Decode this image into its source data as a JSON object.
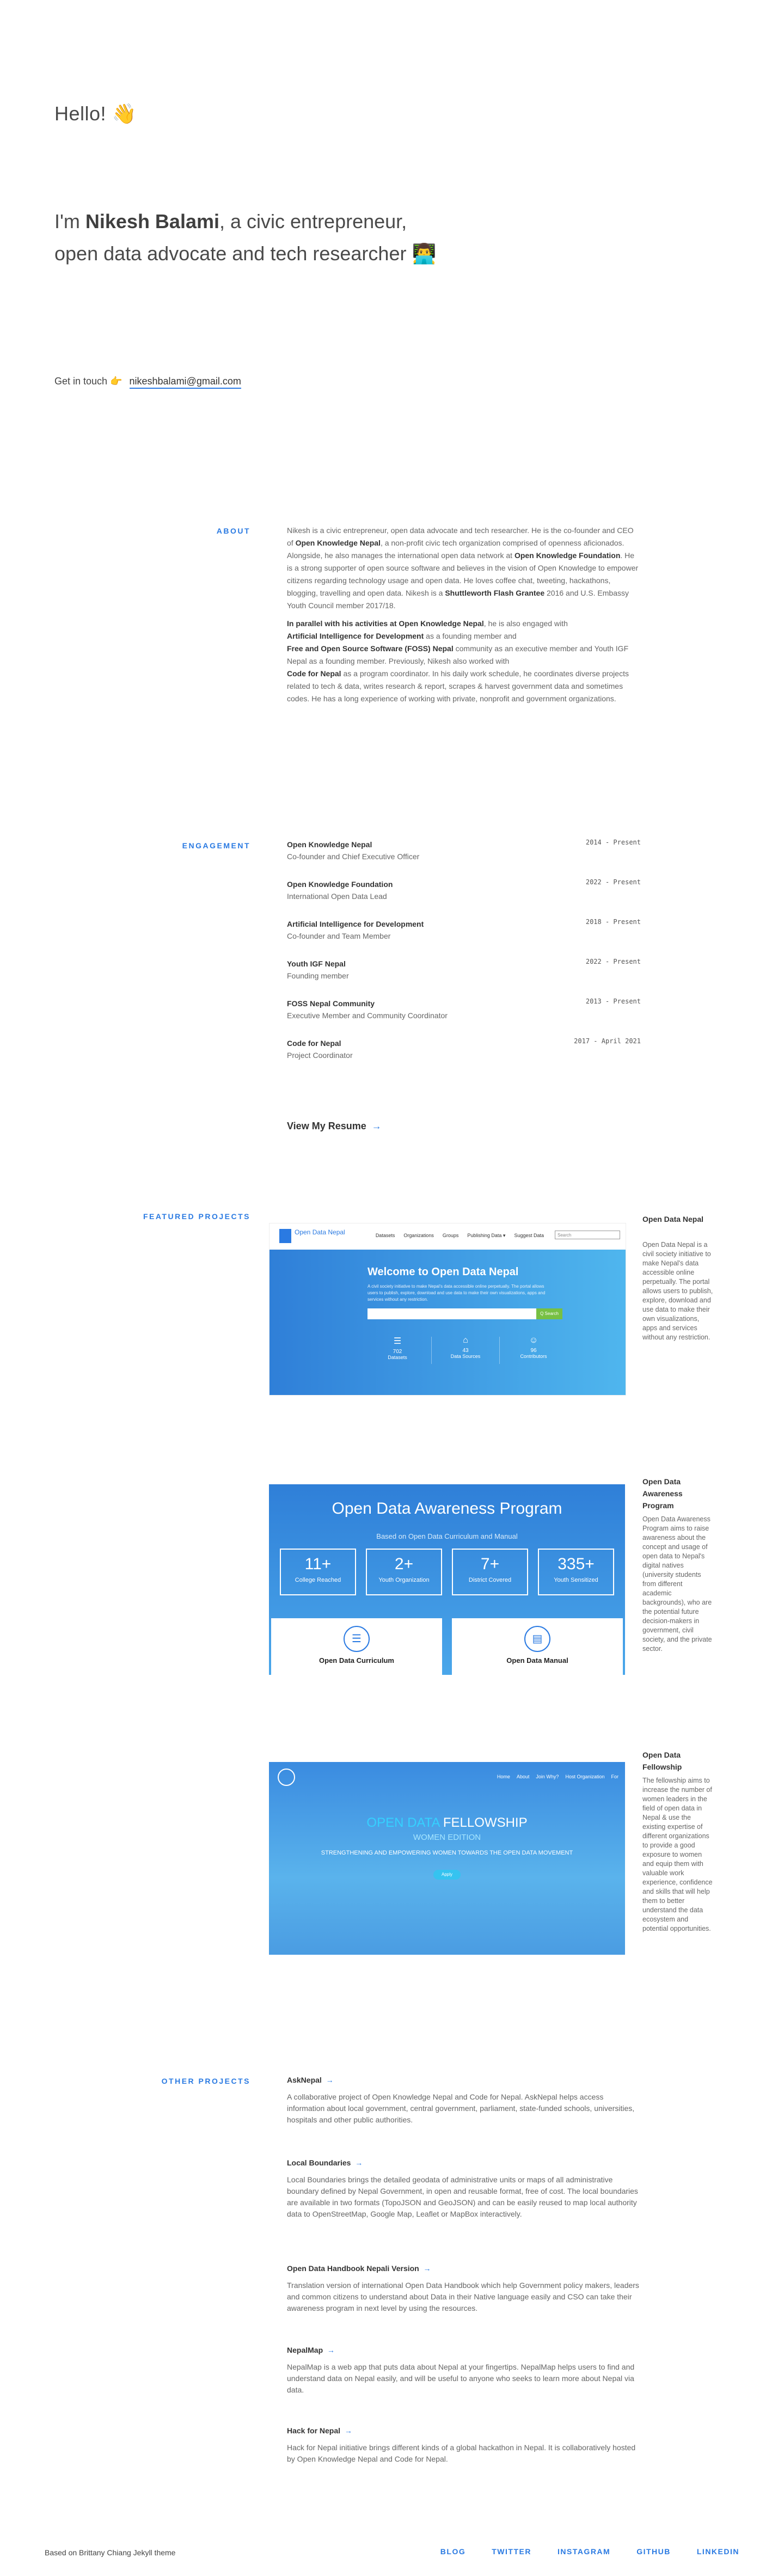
{
  "hero": {
    "greeting": "Hello! 👋",
    "intro_prefix": "I'm ",
    "intro_name": "Nikesh Balami",
    "intro_suffix": ", a civic entrepreneur, open data advocate and tech researcher 👨‍💻",
    "contact_label": "Get in touch 👉",
    "email": "nikeshbalami@gmail.com"
  },
  "about": {
    "label": "ABOUT",
    "p1_a": "Nikesh is a civic entrepreneur, open data advocate and tech researcher. He is the co-founder and CEO of ",
    "p1_b": "Open Knowledge Nepal",
    "p1_c": ", a non-profit civic tech organization comprised of openness aficionados. Alongside, he also manages the international open data network at ",
    "p1_d": "Open Knowledge Foundation",
    "p1_e": ". He is a strong supporter of open source software and believes in the vision of Open Knowledge to empower citizens regarding technology usage and open data. He loves coffee chat, tweeting, hackathons, blogging, travelling and open data. Nikesh is a ",
    "p1_f": "Shuttleworth Flash Grantee",
    "p1_g": " 2016 and U.S. Embassy Youth Council member 2017/18.",
    "p2_a": "In parallel with his activities at Open Knowledge Nepal",
    "p2_b": ", he is also engaged with ",
    "p2_c": "Artificial Intelligence for Development",
    "p2_d": " as a founding member and ",
    "p2_e": "Free and Open Source Software (FOSS) Nepal",
    "p2_f": " community as an executive member and Youth IGF Nepal as a founding member. Previously, Nikesh also worked with ",
    "p2_g": "Code for Nepal",
    "p2_h": " as a program coordinator. In his daily work schedule, he coordinates diverse projects related to tech & data, writes research & report, scrapes & harvest government data and sometimes codes. He has a long experience of working with private, nonprofit and government organizations."
  },
  "engagement": {
    "label": "ENGAGEMENT",
    "items": [
      {
        "org": "Open Knowledge Nepal",
        "role": "Co-founder and Chief Executive Officer",
        "date": "2014 - Present"
      },
      {
        "org": "Open Knowledge Foundation",
        "role": "International Open Data Lead",
        "date": "2022 - Present"
      },
      {
        "org": "Artificial Intelligence for Development",
        "role": "Co-founder and Team Member",
        "date": "2018 - Present"
      },
      {
        "org": "Youth IGF Nepal",
        "role": "Founding member",
        "date": "2022 - Present"
      },
      {
        "org": "FOSS Nepal Community",
        "role": "Executive Member and Community Coordinator",
        "date": "2013 - Present"
      },
      {
        "org": "Code for Nepal",
        "role": "Project Coordinator",
        "date": "2017 - April 2021"
      }
    ],
    "resume_label": "View My Resume",
    "resume_arrow": "→"
  },
  "featured": {
    "label": "FEATURED PROJECTS",
    "projects": [
      {
        "name": "Open Data Nepal",
        "desc": "Open Data Nepal is a civil society initiative to make Nepal's data accessible online perpetually. The portal allows users to publish, explore, download and use data to make their own visualizations, apps and services without any restriction.",
        "shot": {
          "logo": "Open Data Nepal",
          "nav": [
            "Datasets",
            "Organizations",
            "Groups",
            "Publishing Data ▾",
            "Suggest Data"
          ],
          "search": "Search",
          "title": "Welcome to Open Data Nepal",
          "text": "A civil society initiative to make Nepal's data accessible online perpetually. The portal allows users to publish, explore, download and use data to make their own visualizations, apps and services without any restriction.",
          "search_btn": "Q Search",
          "stats": [
            {
              "icon": "☰",
              "value": "702",
              "label": "Datasets"
            },
            {
              "icon": "⌂",
              "value": "43",
              "label": "Data Sources"
            },
            {
              "icon": "☺",
              "value": "96",
              "label": "Contributors"
            }
          ]
        }
      },
      {
        "name": "Open Data Awareness Program",
        "desc": "Open Data Awareness Program aims to raise awareness about the concept and usage of open data to Nepal's digital natives (university students from different academic backgrounds), who are the potential future decision-makers in government, civil society, and the private sector.",
        "shot": {
          "title": "Open Data Awareness Program",
          "subtitle": "Based on Open Data Curriculum and Manual",
          "stats": [
            {
              "value": "11+",
              "label": "College Reached"
            },
            {
              "value": "2+",
              "label": "Youth Organization"
            },
            {
              "value": "7+",
              "label": "District Covered"
            },
            {
              "value": "335+",
              "label": "Youth Sensitized"
            }
          ],
          "cards": [
            "Open Data Curriculum",
            "Open Data Manual"
          ]
        }
      },
      {
        "name": "Open Data Fellowship",
        "desc": "The fellowship aims to increase the number of women leaders in the field of open data in Nepal & use the existing expertise of different organizations to provide a good exposure to women and equip them with valuable work experience, confidence and skills that will help them to better understand the data ecosystem and potential opportunities.",
        "shot": {
          "nav": [
            "Home",
            "About",
            "Join Why?",
            "Host Organization",
            "For"
          ],
          "title_a": "OPEN DATA ",
          "title_b": "FELLOWSHIP",
          "subtitle": "WOMEN EDITION",
          "tagline": "STRENGTHENING AND EMPOWERING WOMEN TOWARDS THE OPEN DATA MOVEMENT",
          "button": "Apply"
        }
      }
    ]
  },
  "other": {
    "label": "OTHER PROJECTS",
    "projects": [
      {
        "name": "AskNepal",
        "desc": "A collaborative project of Open Knowledge Nepal and Code for Nepal. AskNepal helps access information about local government, central government, parliament, state-funded schools, universities, hospitals and other public authorities."
      },
      {
        "name": "Local Boundaries",
        "desc": "Local Boundaries brings the detailed geodata of administrative units or maps of all administrative boundary defined by Nepal Government, in open and reusable format, free of cost. The local boundaries are available in two formats (TopoJSON and GeoJSON) and can be easily reused to map local authority data to OpenStreetMap, Google Map, Leaflet or MapBox interactively."
      },
      {
        "name": "Open Data Handbook Nepali Version",
        "desc": "Translation version of international Open Data Handbook which help Government policy makers, leaders and common citizens to understand about Data in their Native language easily and CSO can take their awareness program in next level by using the resources."
      },
      {
        "name": "NepalMap",
        "desc": "NepalMap is a web app that puts data about Nepal at your fingertips. NepalMap helps users to find and understand data on Nepal easily, and will be useful to anyone who seeks to learn more about Nepal via data."
      },
      {
        "name": "Hack for Nepal",
        "desc": "Hack for Nepal initiative brings different kinds of a global hackathon in Nepal. It is collaboratively hosted by Open Knowledge Nepal and Code for Nepal."
      }
    ],
    "arrow": "→"
  },
  "footer": {
    "credit": "Based on Brittany Chiang Jekyll theme",
    "links": [
      "BLOG",
      "TWITTER",
      "INSTAGRAM",
      "GITHUB",
      "LINKEDIN"
    ]
  },
  "colors": {
    "accent": "#2a7ae2",
    "text": "#555555",
    "heading": "#333333"
  }
}
